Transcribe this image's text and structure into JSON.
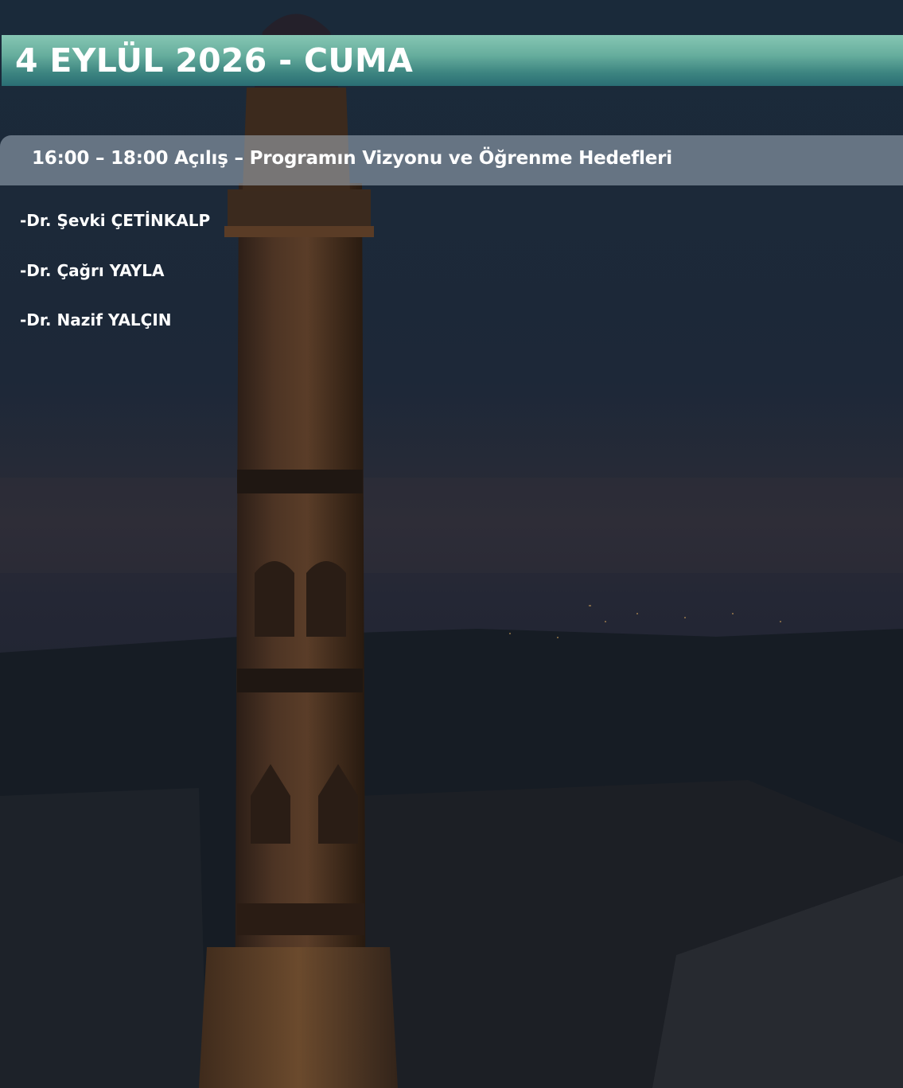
{
  "program": {
    "date_heading": "4 EYLÜL 2026 - CUMA",
    "sessions": [
      {
        "title": "16:00 – 18:00 Açılış – Programın Vizyonu ve Öğrenme Hedefleri",
        "speakers": [
          "-Dr. Şevki ÇETİNKALP",
          "-Dr. Çağrı YAYLA",
          "-Dr. Nazif YALÇIN"
        ]
      }
    ]
  },
  "colors": {
    "header_bar_top": "#86c6b3",
    "header_bar_bottom": "#2a6e74",
    "session_bar": "#b2c0ce",
    "text": "#ffffff",
    "background": "#1b2535"
  }
}
